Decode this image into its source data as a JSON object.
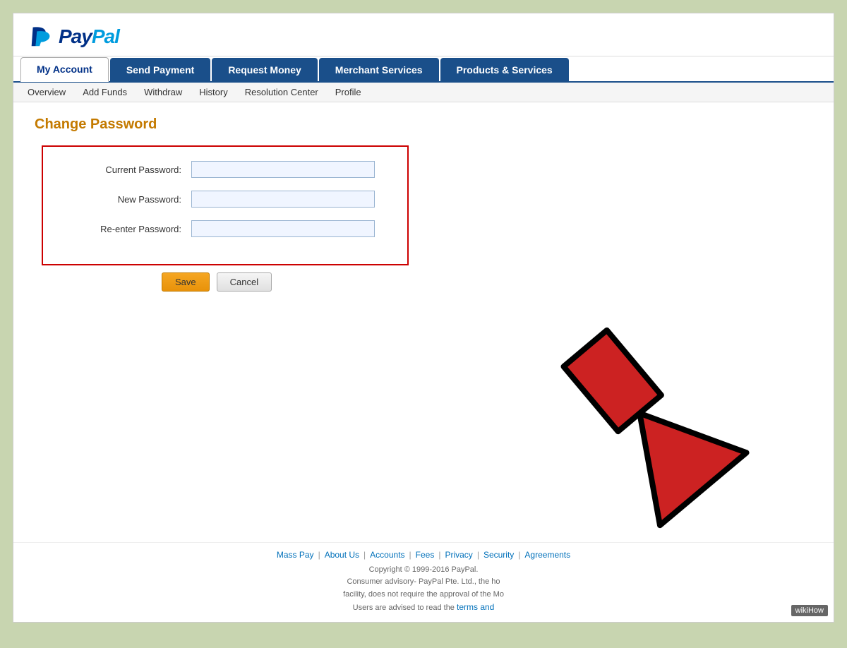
{
  "logo": {
    "text_blue": "Pay",
    "text_lightblue": "Pal"
  },
  "nav": {
    "tabs": [
      {
        "label": "My Account",
        "active": true,
        "dark": false
      },
      {
        "label": "Send Payment",
        "active": false,
        "dark": true
      },
      {
        "label": "Request Money",
        "active": false,
        "dark": true
      },
      {
        "label": "Merchant Services",
        "active": false,
        "dark": true
      },
      {
        "label": "Products & Services",
        "active": false,
        "dark": true
      }
    ],
    "sub_items": [
      {
        "label": "Overview"
      },
      {
        "label": "Add Funds"
      },
      {
        "label": "Withdraw"
      },
      {
        "label": "History"
      },
      {
        "label": "Resolution Center"
      },
      {
        "label": "Profile"
      }
    ]
  },
  "page": {
    "title": "Change Password",
    "form": {
      "current_password_label": "Current Password:",
      "new_password_label": "New Password:",
      "reenter_password_label": "Re-enter Password:",
      "save_btn": "Save",
      "cancel_btn": "Cancel"
    }
  },
  "footer": {
    "links": [
      {
        "label": "Mass Pay"
      },
      {
        "label": "About Us"
      },
      {
        "label": "Accounts"
      },
      {
        "label": "Fees"
      },
      {
        "label": "Privacy"
      },
      {
        "label": "Security"
      },
      {
        "label": "Agreements"
      }
    ],
    "copyright": "Copyright © 1999-2016 PayPal.",
    "advisory1": "Consumer advisory- PayPal Pte. Ltd., the ho",
    "advisory2": "facility, does not require the approval of the Mo",
    "advisory3": "Users are advised to read the",
    "terms_link": "terms and"
  },
  "wikihow": "wikiHow"
}
